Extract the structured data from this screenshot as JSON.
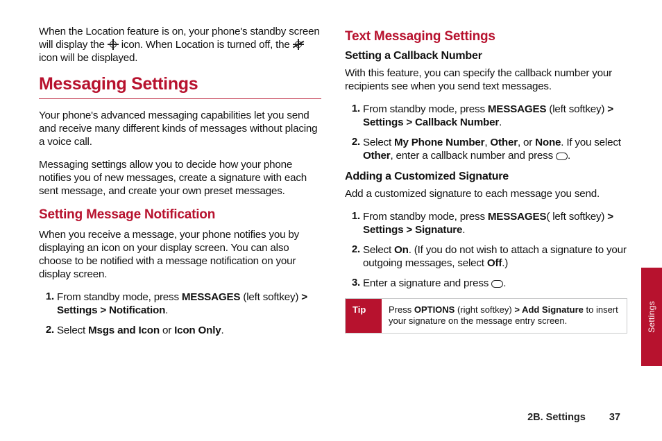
{
  "left": {
    "intro_before_icon1": "When the Location feature is on, your phone's standby screen will display the ",
    "intro_between": " icon. When Location is turned off, the ",
    "intro_after_icon2": " icon will be displayed.",
    "h1": "Messaging Settings",
    "p1": "Your phone's advanced messaging capabilities let you send and receive many different kinds of messages without placing a voice call.",
    "p2": "Messaging settings allow you to decide how your phone notifies you of new messages, create a signature with each sent message, and create your own preset messages.",
    "h2": "Setting Message Notification",
    "p3": "When you receive a message, your phone notifies you by displaying an icon on your display screen. You can also choose to be notified with a message notification on your display screen.",
    "steps": [
      {
        "num": "1.",
        "pre": "From standby mode, press ",
        "b1": "MESSAGES",
        "mid": " (left softkey) ",
        "b2": "> Settings > Notification",
        "post": "."
      },
      {
        "num": "2.",
        "pre": "Select ",
        "b1": "Msgs and Icon",
        "mid": " or ",
        "b2": "Icon Only",
        "post": "."
      }
    ]
  },
  "right": {
    "h2": "Text Messaging Settings",
    "sec1": {
      "h3": "Setting a Callback Number",
      "p": "With this feature, you can specify the callback number your recipients see when you send text messages.",
      "steps": [
        {
          "num": "1.",
          "pre": "From standby mode, press ",
          "b1": "MESSAGES",
          "mid": " (left softkey) ",
          "b2": "> Settings > Callback Number",
          "post": "."
        },
        {
          "num": "2.",
          "pre": "Select ",
          "b1": "My Phone Number",
          "mid": ", ",
          "b2": "Other",
          "mid2": ", or ",
          "b3": "None",
          "pre2": ". If you select ",
          "b4": "Other",
          "post": ", enter a callback number and press ",
          "pill": true,
          "post2": "."
        }
      ]
    },
    "sec2": {
      "h3": "Adding a Customized Signature",
      "p": "Add a customized signature to each message you send.",
      "steps": [
        {
          "num": "1.",
          "pre": "From standby mode, press ",
          "b1": "MESSAGES",
          "mid": "( left softkey) ",
          "b2": "> Settings > Signature",
          "post": "."
        },
        {
          "num": "2.",
          "pre": "Select ",
          "b1": "On",
          "mid": ". (If you do not wish to attach a signature to your outgoing messages, select ",
          "b2": "Off",
          "post": ".)"
        },
        {
          "num": "3.",
          "pre": "Enter a signature and press ",
          "pill": true,
          "post": "."
        }
      ]
    },
    "tip": {
      "label": "Tip",
      "pre": "Press ",
      "b1": "OPTIONS",
      "mid1": " (right softkey) ",
      "b2": "> Add Signature",
      "post": " to insert your signature on the message entry screen."
    }
  },
  "sidetab": "Settings",
  "footer": {
    "section": "2B. Settings",
    "page": "37"
  }
}
